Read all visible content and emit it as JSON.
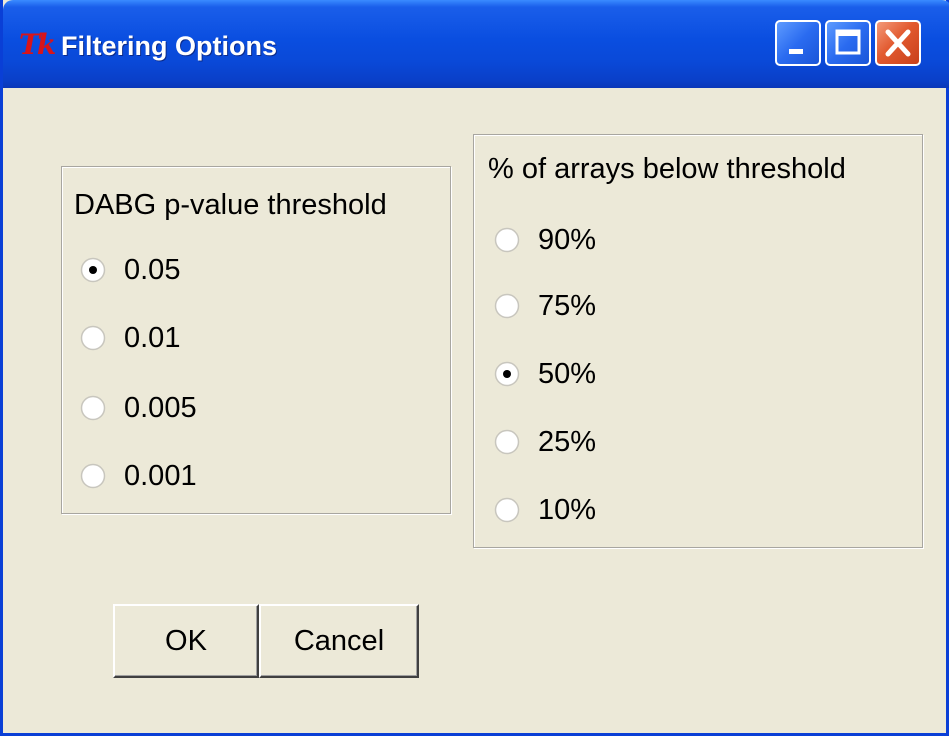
{
  "window": {
    "title": "Filtering Options",
    "logo_text": "Tk"
  },
  "pvalue_group": {
    "title": "DABG p-value threshold",
    "options": [
      "0.05",
      "0.01",
      "0.005",
      "0.001"
    ],
    "selected": "0.05"
  },
  "percent_group": {
    "title": "% of arrays below threshold",
    "options": [
      "90%",
      "75%",
      "50%",
      "25%",
      "10%"
    ],
    "selected": "50%"
  },
  "buttons": {
    "ok": "OK",
    "cancel": "Cancel"
  },
  "colors": {
    "titlebar": "#0A4EE0",
    "background": "#ECE9D8",
    "close_button": "#E25A30"
  }
}
